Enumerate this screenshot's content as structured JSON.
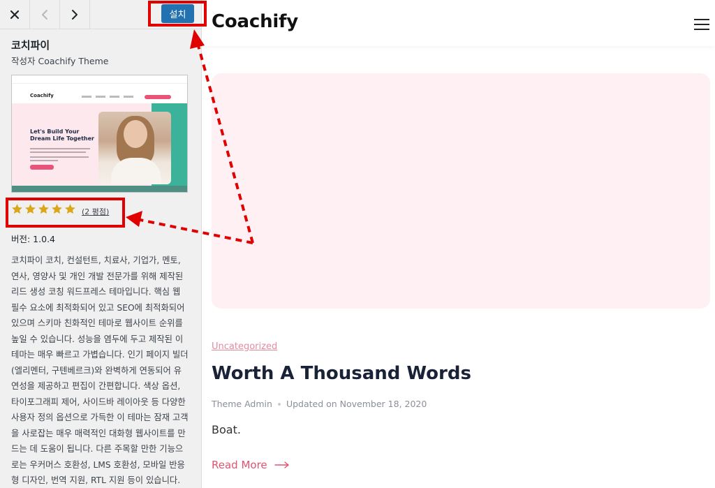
{
  "header": {
    "close_label": "×",
    "install_label": "설치",
    "icons": [
      "close-icon",
      "chevron-left-icon",
      "chevron-right-icon"
    ]
  },
  "theme": {
    "name": "코치파이",
    "author": "작성자 Coachify Theme",
    "rating": 5,
    "rating_max": 5,
    "reviews": "(2 평점)",
    "version": "버전: 1.0.4",
    "description": "코치파이 코치, 컨설턴트, 치료사, 기업가, 멘토, 연사, 영양사 및 개인 개발 전문가를 위해 제작된 리드 생성 코칭 워드프레스 테마입니다. 핵심 웹 필수 요소에 최적화되어 있고 SEO에 최적화되어 있으며 스키마 친화적인 테마로 웹사이트 순위를 높일 수 있습니다. 성능을 염두에 두고 제작된 이 테마는 매우 빠르고 가볍습니다. 인기 페이지 빌더(엘리멘터, 구텐베르크)와 완벽하게 연동되어 유연성을 제공하고 편집이 간편합니다. 색상 옵션, 타이포그래피 제어, 사이드바 레이아웃 등 다양한 사용자 정의 옵션으로 가득한 이 테마는 잠재 고객을 사로잡는 매우 매력적인 대화형 웹사이트를 만드는 데 도움이 됩니다. 다른 주목할 만한 기능으로는 우커머스 호환성, LMS 호환성, 모바일 반응형 디자인, 번역 지원, RTL 지원 등이 있습니다. 시작 템플릿은 여기에서 확",
    "screenshot": {
      "logo": "Coachify",
      "headline": "Let's Build Your Dream Life Together"
    }
  },
  "preview": {
    "site_title": "Coachify",
    "category": "Uncategorized",
    "post_title": "Worth A Thousand Words",
    "author": "Theme Admin",
    "updated": "Updated on November 18, 2020",
    "excerpt": "Boat.",
    "read_more": "Read More"
  },
  "colors": {
    "install_button": "#2271b1",
    "highlight": "#e00000",
    "star": "#dba617",
    "featured_bg": "#fef0f3",
    "category": "#e38aa0",
    "read_more": "#e4526f",
    "post_title": "#1a2238"
  }
}
